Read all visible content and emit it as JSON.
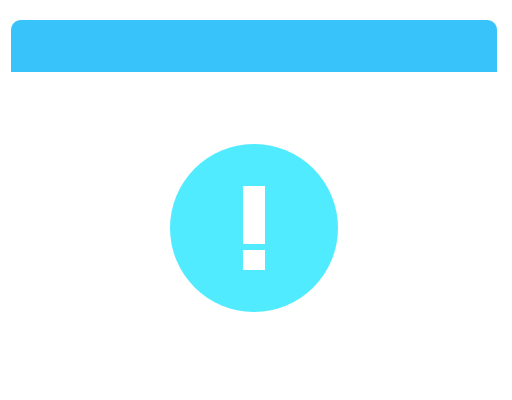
{
  "header": {
    "color": "#38c4fb"
  },
  "alert": {
    "icon": "exclamation-circle-icon",
    "circle_color": "#50ebff",
    "glyph_color": "#ffffff"
  }
}
